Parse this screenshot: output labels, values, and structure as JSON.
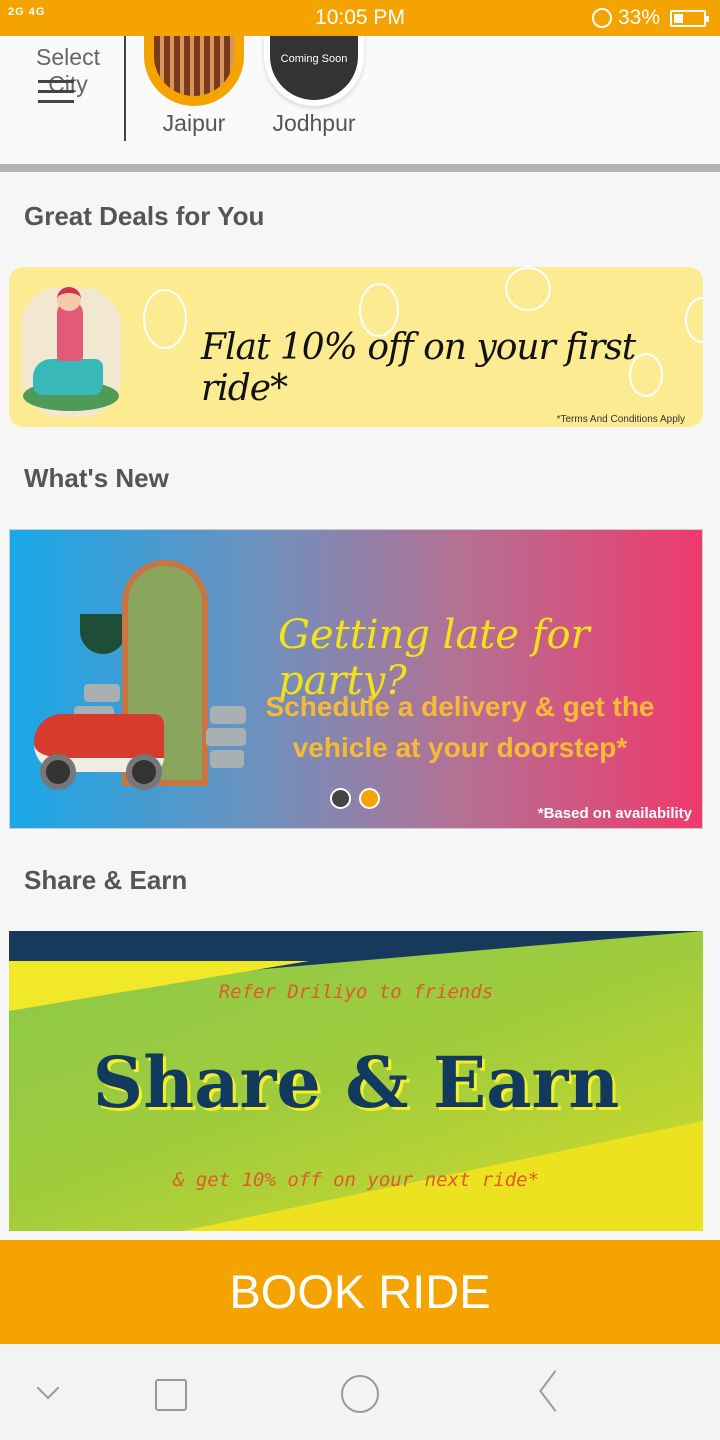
{
  "status_bar": {
    "signal": "2G 4G",
    "time": "10:05 PM",
    "battery": "33%"
  },
  "city_selector": {
    "label": "Select City",
    "cities": [
      {
        "name": "Jaipur",
        "selected": true
      },
      {
        "name": "Jodhpur",
        "badge": "Coming Soon"
      }
    ]
  },
  "sections": {
    "deals": {
      "title": "Great Deals for You"
    },
    "whats_new": {
      "title": "What's New"
    },
    "share_earn": {
      "title": "Share & Earn"
    }
  },
  "deal_banner": {
    "headline": "Flat 10% off on your first ride*",
    "terms": "*Terms And Conditions Apply"
  },
  "new_banner": {
    "headline": "Getting late for party?",
    "subline": "Schedule a delivery & get the vehicle at your doorstep*",
    "note": "*Based on availability",
    "carousel": {
      "count": 2,
      "active_index": 1
    }
  },
  "share_banner": {
    "top_line": "Refer Driliyo to friends",
    "headline": "Share & Earn",
    "bottom_line": "& get 10% off on your next ride*"
  },
  "book_button": {
    "label": "BOOK RIDE"
  },
  "colors": {
    "accent": "#f5a300",
    "dot_inactive": "#444444",
    "dot_active": "#f5a300"
  },
  "nav_icons": [
    "chevron-down-icon",
    "recent-apps-icon",
    "home-icon",
    "back-icon"
  ]
}
